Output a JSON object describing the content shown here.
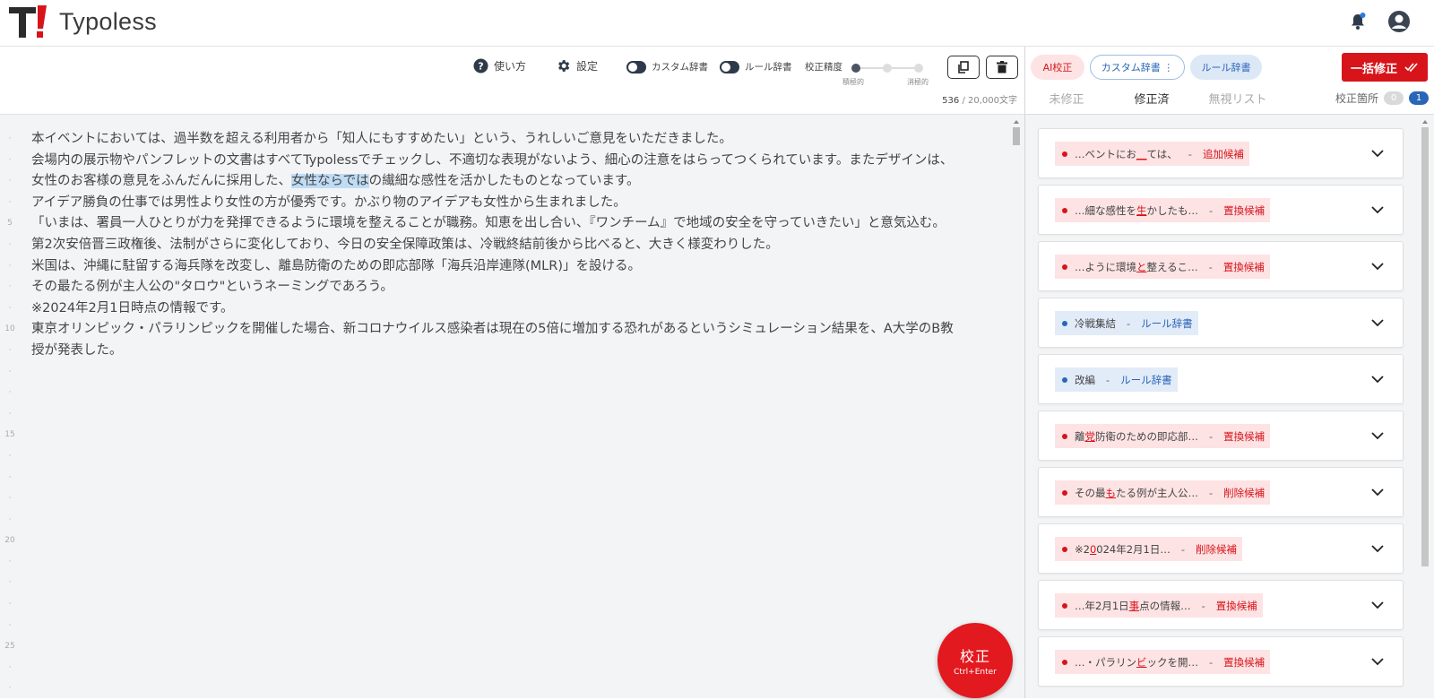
{
  "app": {
    "name": "Typoless",
    "accent": "#d7141a"
  },
  "toolbar": {
    "help_label": "使い方",
    "settings_label": "設定",
    "custom_dict_label": "カスタム辞書",
    "rule_dict_label": "ルール辞書",
    "accuracy_label": "校正精度",
    "accuracy_low": "積極的",
    "accuracy_high": "消極的",
    "accuracy_level": 0,
    "char_count": "536",
    "char_limit": "/ 20,000文字"
  },
  "editor": {
    "gutter": [
      "·",
      "·",
      "·",
      "·",
      "5",
      "·",
      "·",
      "·",
      "·",
      "10",
      "·",
      "·",
      "·",
      "·",
      "15",
      "·",
      "·",
      "·",
      "·",
      "20",
      "·",
      "·",
      "·",
      "·",
      "25",
      "·",
      "·"
    ],
    "lines": [
      {
        "before": "本イベントにおいては、過半数を超える利用者から「知人にもすすめたい」という、うれしいご意見をいただきました。",
        "hl": "",
        "after": ""
      },
      {
        "before": "会場内の展示物やパンフレットの文書はすべてTypolessでチェックし、不適切な表現がないよう、細心の注意をはらってつくられています。またデザインは、",
        "hl": "",
        "after": ""
      },
      {
        "before": "女性のお客様の意見をふんだんに採用した、",
        "hl": "女性ならでは",
        "after": "の繊細な感性を活かしたものとなっています。"
      },
      {
        "before": "アイデア勝負の仕事では男性より女性の方が優秀です。かぶり物のアイデアも女性から生まれました。",
        "hl": "",
        "after": ""
      },
      {
        "before": "「いまは、署員一人ひとりが力を発揮できるように環境を整えることが職務。知恵を出し合い、『ワンチーム』で地域の安全を守っていきたい」と意気込む。",
        "hl": "",
        "after": ""
      },
      {
        "before": "第2次安倍晋三政権後、法制がさらに変化しており、今日の安全保障政策は、冷戦終結前後から比べると、大きく様変わりした。",
        "hl": "",
        "after": ""
      },
      {
        "before": "米国は、沖縄に駐留する海兵隊を改変し、離島防衛のための即応部隊「海兵沿岸連隊(MLR)」を設ける。",
        "hl": "",
        "after": ""
      },
      {
        "before": "その最たる例が主人公の\"タロウ\"というネーミングであろう。",
        "hl": "",
        "after": ""
      },
      {
        "before": "※2024年2月1日時点の情報です。",
        "hl": "",
        "after": ""
      },
      {
        "before": "東京オリンピック・パラリンピックを開催した場合、新コロナウイルス感染者は現在の5倍に増加する恐れがあるというシミュレーション結果を、A大学のB教",
        "hl": "",
        "after": ""
      },
      {
        "before": "授が発表した。",
        "hl": "",
        "after": ""
      }
    ],
    "submit_label": "校正",
    "submit_shortcut": "Ctrl+Enter"
  },
  "panel": {
    "ai_label": "AI校正",
    "custom_dict_label": "カスタム辞書 ⋮",
    "rule_dict_label": "ルール辞書",
    "fix_all_label": "一括修正",
    "tabs": [
      "未修正",
      "修正済",
      "無視リスト"
    ],
    "active_tab": 1,
    "count_label": "校正箇所",
    "count_a": "0",
    "count_b": "1",
    "items": [
      {
        "kind": "red",
        "pre": "…ベントにお",
        "mark": "__",
        "post": "ては、",
        "tag": "追加候補"
      },
      {
        "kind": "red",
        "pre": "…細な感性を",
        "mark": "生",
        "post": "かしたも…",
        "tag": "置換候補"
      },
      {
        "kind": "red",
        "pre": "…ように環境",
        "mark": "と",
        "post": "整えるこ…",
        "tag": "置換候補"
      },
      {
        "kind": "blue",
        "pre": "冷戦集結",
        "mark": "",
        "post": "",
        "tag": "ルール辞書"
      },
      {
        "kind": "blue",
        "pre": "改編",
        "mark": "",
        "post": "",
        "tag": "ルール辞書"
      },
      {
        "kind": "red",
        "pre": "離",
        "mark": "党",
        "post": "防衛のための即応部…",
        "tag": "置換候補"
      },
      {
        "kind": "red",
        "pre": "その最",
        "mark": "も",
        "post": "たる例が主人公…",
        "tag": "削除候補"
      },
      {
        "kind": "red",
        "pre": "※2",
        "mark": "0",
        "post": "024年2月1日…",
        "tag": "削除候補"
      },
      {
        "kind": "red",
        "pre": "…年2月1日",
        "mark": "事",
        "post": "点の情報…",
        "tag": "置換候補"
      },
      {
        "kind": "red",
        "pre": "…・パラリン",
        "mark": "ビ",
        "post": "ックを開…",
        "tag": "置換候補"
      }
    ]
  }
}
